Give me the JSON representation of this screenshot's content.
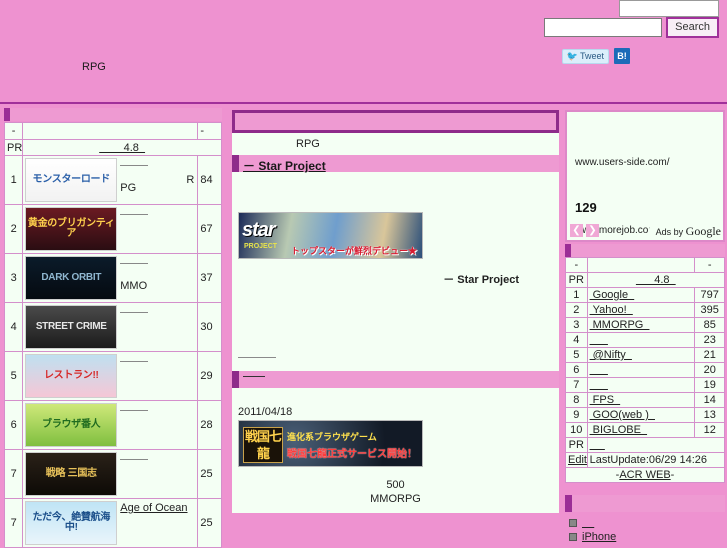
{
  "header": {
    "left_link": "",
    "subtitle": "RPG",
    "search": {
      "value": "",
      "placeholder": "",
      "button_label": "Search"
    },
    "social": {
      "tweet_label": "Tweet",
      "hatena_label": "B!"
    },
    "colors": {
      "header_pink": "#ee92d0",
      "accent_purple": "#9b2d96",
      "panel_mint": "#f4fff4"
    }
  },
  "left": {
    "table_header": {
      "col1": "-",
      "col2": "",
      "col3": "-"
    },
    "pr_row": {
      "label": "PR",
      "value": "4.8"
    },
    "rows": [
      {
        "rank": "1",
        "thumb_text": "モンスターロード",
        "thumb_bg": "linear-gradient(180deg,#ffffff,#f2f2f2)",
        "thumb_color": "#2a5fa8",
        "title": "",
        "genre": "PG",
        "tag": "R",
        "value": "84"
      },
      {
        "rank": "2",
        "thumb_text": "黄金のブリガンティア",
        "thumb_bg": "linear-gradient(180deg,#6b1a22,#2a0d12)",
        "thumb_color": "#ffd24d",
        "title": "",
        "genre": "",
        "tag": "",
        "value": "67"
      },
      {
        "rank": "3",
        "thumb_text": "DARK ORBIT",
        "thumb_bg": "linear-gradient(180deg,#0b1b2a,#050a10)",
        "thumb_color": "#8fb6cf",
        "title": "",
        "genre": "MMO",
        "tag": "",
        "value": "37"
      },
      {
        "rank": "4",
        "thumb_text": "STREET CRIME",
        "thumb_bg": "linear-gradient(180deg,#4a4a4a,#1c1c1c)",
        "thumb_color": "#e8e8e8",
        "title": "",
        "genre": "",
        "tag": "",
        "value": "30"
      },
      {
        "rank": "5",
        "thumb_text": "レストラン!!",
        "thumb_bg": "linear-gradient(180deg,#bfe0f0,#f5c7d6)",
        "thumb_color": "#d62828",
        "title": "",
        "genre": "",
        "tag": "",
        "value": "29"
      },
      {
        "rank": "6",
        "thumb_text": "ブラウザ番人",
        "thumb_bg": "linear-gradient(180deg,#cfe87a,#7fbf3f)",
        "thumb_color": "#1f6b1f",
        "title": "",
        "genre": "",
        "tag": "",
        "value": "28"
      },
      {
        "rank": "7",
        "thumb_text": "戦略 三国志",
        "thumb_bg": "linear-gradient(180deg,#2a2118,#0d0a06)",
        "thumb_color": "#e8c25a",
        "title": "",
        "genre": "",
        "tag": "",
        "value": "25"
      },
      {
        "rank": "7",
        "thumb_text": "ただ今、絶賛航海中!",
        "thumb_bg": "linear-gradient(180deg,#bfe4f5,#e9f5fb)",
        "thumb_color": "#1b4f8a",
        "title": "Age of Ocean",
        "genre": "",
        "tag": "",
        "value": "25"
      }
    ]
  },
  "center": {
    "breadcrumb": "RPG",
    "section_title": "－ Star Project",
    "banner1": {
      "logo": "star",
      "sub": "PROJECT",
      "jp": "トップスターが鮮烈デビュー★"
    },
    "caption1": "－ Star Project",
    "section2_title": "",
    "date": "2011/04/18",
    "banner2": {
      "kanji": "戦国七龍",
      "line1": "進化系ブラウザゲーム",
      "line2": "戦国七龍正式サービス開始！"
    },
    "stat_number": "500",
    "stat_label": "MMORPG"
  },
  "right": {
    "ad": {
      "url1": "www.users-side.com/",
      "big": "129",
      "url2": "www.morejob.com",
      "prev": "❮",
      "next": "❯",
      "ads_by_pre": "Ads by ",
      "ads_by_brand": "Google"
    },
    "table_header": {
      "col1": "-",
      "col2": "",
      "col3": "-"
    },
    "pr_row": {
      "label": "PR",
      "value": "4.8"
    },
    "rows": [
      {
        "rank": "1",
        "name": "Google",
        "value": "797"
      },
      {
        "rank": "2",
        "name": "Yahoo!",
        "value": "395"
      },
      {
        "rank": "3",
        "name": "MMORPG",
        "value": "85"
      },
      {
        "rank": "4",
        "name": "",
        "value": "23"
      },
      {
        "rank": "5",
        "name": "@Nifty",
        "value": "21"
      },
      {
        "rank": "6",
        "name": "",
        "value": "20"
      },
      {
        "rank": "7",
        "name": "",
        "value": "19"
      },
      {
        "rank": "8",
        "name": "FPS",
        "value": "14"
      },
      {
        "rank": "9",
        "name": "GOO(web )",
        "value": "13"
      },
      {
        "rank": "10",
        "name": "BIGLOBE",
        "value": "12"
      }
    ],
    "pr_row_bottom": {
      "label": "PR",
      "value": ""
    },
    "edit_row": {
      "edit_label": "Edit",
      "text": "LastUpdate:06/29 14:26"
    },
    "footer_row": "-ACR WEB-",
    "list_heading": "",
    "list_items": [
      "",
      "iPhone"
    ]
  }
}
